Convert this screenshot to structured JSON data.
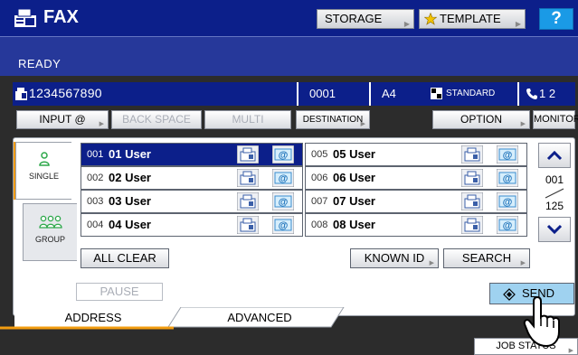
{
  "header": {
    "title": "FAX",
    "storage_label": "STORAGE",
    "template_label": "TEMPLATE",
    "help_label": "?"
  },
  "status": {
    "text": "READY"
  },
  "info": {
    "fax_number": "1234567890",
    "count": "0001",
    "paper_size": "A4",
    "resolution": "STANDARD",
    "lines": "1  2"
  },
  "toolbar": {
    "input_label": "INPUT @",
    "backspace_label": "BACK SPACE",
    "multi_label": "MULTI",
    "destination_label": "DESTINATION",
    "option_label": "OPTION",
    "monitor_label": "MONITOR"
  },
  "side_tabs": {
    "single": "SINGLE",
    "group": "GROUP"
  },
  "users": [
    {
      "id": "001",
      "name": "01 User",
      "selected": true
    },
    {
      "id": "002",
      "name": "02 User",
      "selected": false
    },
    {
      "id": "003",
      "name": "03 User",
      "selected": false
    },
    {
      "id": "004",
      "name": "04 User",
      "selected": false
    },
    {
      "id": "005",
      "name": "05 User",
      "selected": false
    },
    {
      "id": "006",
      "name": "06 User",
      "selected": false
    },
    {
      "id": "007",
      "name": "07 User",
      "selected": false
    },
    {
      "id": "008",
      "name": "08 User",
      "selected": false
    }
  ],
  "paging": {
    "current": "001",
    "total": "125"
  },
  "panel_buttons": {
    "all_clear": "ALL CLEAR",
    "known_id": "KNOWN ID",
    "search": "SEARCH"
  },
  "actions": {
    "pause": "PAUSE",
    "send": "SEND"
  },
  "bottom_tabs": {
    "address": "ADDRESS",
    "advanced": "ADVANCED",
    "job_status": "JOB STATUS"
  },
  "colors": {
    "header_bg": "#0c1f8a",
    "status_bg": "#26389a",
    "tab_accent": "#f29c11",
    "send_bg": "#9fd2f0",
    "help_bg": "#1a9ae6"
  },
  "icons": {
    "fax": "fax-machine-icon",
    "email": "at-sign-icon",
    "template": "star-icon",
    "single": "single-person-icon",
    "group": "group-people-icon",
    "send": "diamond-icon"
  }
}
